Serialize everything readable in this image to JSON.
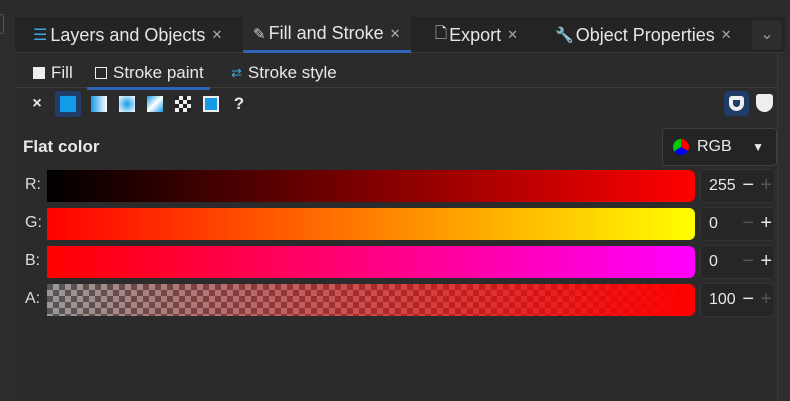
{
  "tabs": [
    {
      "label": "Layers and Objects",
      "icon": "layers-icon"
    },
    {
      "label": "Fill and Stroke",
      "icon": "fill-stroke-icon",
      "active": true
    },
    {
      "label": "Export",
      "icon": "export-icon"
    },
    {
      "label": "Object Properties",
      "icon": "wrench-icon"
    }
  ],
  "subtabs": {
    "fill": "Fill",
    "stroke_paint": "Stroke paint",
    "stroke_style": "Stroke style"
  },
  "paint_icons": {
    "none": "×",
    "unknown": "?"
  },
  "flat_color": "Flat color",
  "color_mode": "RGB",
  "channels": [
    {
      "label": "R:",
      "value": "255",
      "gradient": "linear-gradient(90deg,#000,#ff0000)"
    },
    {
      "label": "G:",
      "value": "0",
      "gradient": "linear-gradient(90deg,#ff0000,#ffff00)"
    },
    {
      "label": "B:",
      "value": "0",
      "gradient": "linear-gradient(90deg,#ff0000,#ff00ff)"
    },
    {
      "label": "A:",
      "value": "100",
      "gradient": "checker"
    }
  ],
  "accent": "#2d64b8"
}
